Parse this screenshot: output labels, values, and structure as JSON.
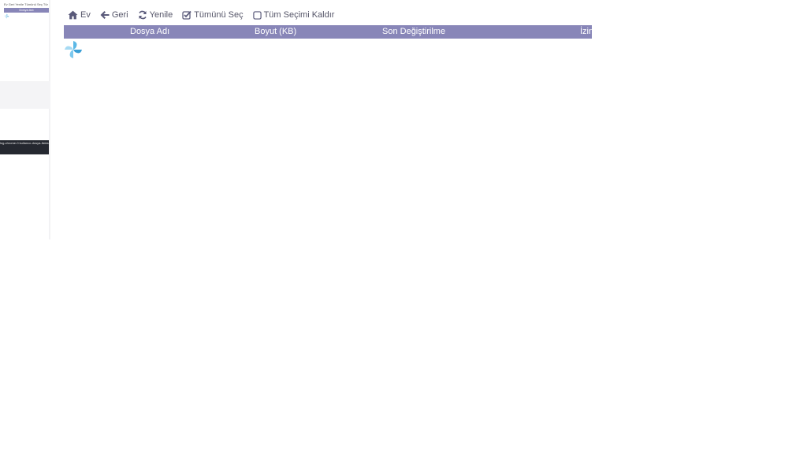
{
  "thumbnail": {
    "toolbar_text": "Ev Geri Yenile Tümünü Seç Tüm Seçimi Kaldır",
    "header_text": "Dosya Adı",
    "strip_text": "log-chrome-0 kullanıcı-dosya-listesi"
  },
  "toolbar": {
    "home_label": "Ev",
    "back_label": "Geri",
    "refresh_label": "Yenile",
    "select_all_label": "Tümünü Seç",
    "deselect_all_label": "Tüm Seçimi Kaldır"
  },
  "table": {
    "columns": [
      "Dosya Adı",
      "Boyut (KB)",
      "Son Değiştirilme",
      "İzin"
    ]
  },
  "colors": {
    "header_bg": "#8886b8",
    "toolbar_icon": "#5a5a7a",
    "spinner": "#5bb8e6"
  },
  "icons": {
    "home": "home-icon",
    "back": "arrow-left-icon",
    "refresh": "refresh-icon",
    "select_all": "checkbox-checked-icon",
    "deselect_all": "checkbox-empty-icon",
    "loading": "pinwheel-spinner-icon"
  }
}
